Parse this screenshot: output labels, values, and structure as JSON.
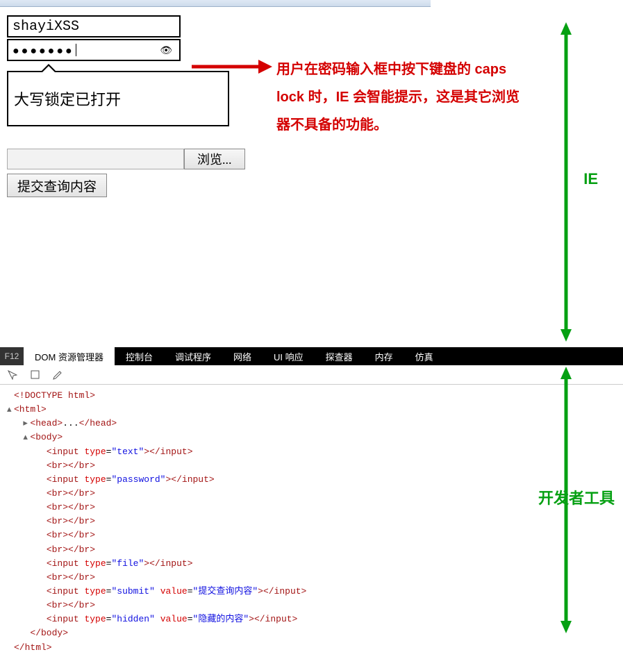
{
  "form": {
    "username_value": "shayiXSS",
    "password_dots": "●●●●●●●",
    "caps_tooltip": "大写锁定已打开",
    "browse_label": "浏览...",
    "submit_label": "提交查询内容"
  },
  "annotations": {
    "red_text": "用户在密码输入框中按下键盘的 caps lock 时，IE 会智能提示，这是其它浏览器不具备的功能。",
    "ie_label": "IE",
    "devtools_label": "开发者工具"
  },
  "devtools": {
    "f12": "F12",
    "tabs": [
      "DOM 资源管理器",
      "控制台",
      "调试程序",
      "网络",
      "UI 响应",
      "探查器",
      "内存",
      "仿真"
    ],
    "dom_lines": [
      {
        "i": 0,
        "pre": "  ",
        "html": "<span class='tag'>&lt;!DOCTYPE html&gt;</span>"
      },
      {
        "i": 0,
        "pre": "▴ ",
        "html": "<span class='tag'>&lt;html&gt;</span>"
      },
      {
        "i": 1,
        "pre": "▸ ",
        "html": "<span class='tag'>&lt;head&gt;</span><span class='txt'>...</span><span class='tag'>&lt;/head&gt;</span>"
      },
      {
        "i": 1,
        "pre": "▴ ",
        "html": "<span class='tag'>&lt;body&gt;</span>"
      },
      {
        "i": 2,
        "pre": "  ",
        "html": "<span class='tag'>&lt;input</span> <span class='attn'>type</span>=<span class='attv'>\"text\"</span><span class='tag'>&gt;&lt;/input&gt;</span>"
      },
      {
        "i": 2,
        "pre": "  ",
        "html": "<span class='tag'>&lt;br&gt;&lt;/br&gt;</span>"
      },
      {
        "i": 2,
        "pre": "  ",
        "html": "<span class='tag'>&lt;input</span> <span class='attn'>type</span>=<span class='attv'>\"password\"</span><span class='tag'>&gt;&lt;/input&gt;</span>"
      },
      {
        "i": 2,
        "pre": "  ",
        "html": "<span class='tag'>&lt;br&gt;&lt;/br&gt;</span>"
      },
      {
        "i": 2,
        "pre": "  ",
        "html": "<span class='tag'>&lt;br&gt;&lt;/br&gt;</span>"
      },
      {
        "i": 2,
        "pre": "  ",
        "html": "<span class='tag'>&lt;br&gt;&lt;/br&gt;</span>"
      },
      {
        "i": 2,
        "pre": "  ",
        "html": "<span class='tag'>&lt;br&gt;&lt;/br&gt;</span>"
      },
      {
        "i": 2,
        "pre": "  ",
        "html": "<span class='tag'>&lt;br&gt;&lt;/br&gt;</span>"
      },
      {
        "i": 2,
        "pre": "  ",
        "html": "<span class='tag'>&lt;input</span> <span class='attn'>type</span>=<span class='attv'>\"file\"</span><span class='tag'>&gt;&lt;/input&gt;</span>"
      },
      {
        "i": 2,
        "pre": "  ",
        "html": "<span class='tag'>&lt;br&gt;&lt;/br&gt;</span>"
      },
      {
        "i": 2,
        "pre": "  ",
        "html": "<span class='tag'>&lt;input</span> <span class='attn'>type</span>=<span class='attv'>\"submit\"</span> <span class='attn'>value</span>=<span class='attv'>\"提交查询内容\"</span><span class='tag'>&gt;&lt;/input&gt;</span>"
      },
      {
        "i": 2,
        "pre": "  ",
        "html": "<span class='tag'>&lt;br&gt;&lt;/br&gt;</span>"
      },
      {
        "i": 2,
        "pre": "  ",
        "html": "<span class='tag'>&lt;input</span> <span class='attn'>type</span>=<span class='attv'>\"hidden\"</span> <span class='attn'>value</span>=<span class='attv'>\"隐藏的内容\"</span><span class='tag'>&gt;&lt;/input&gt;</span>"
      },
      {
        "i": 1,
        "pre": "  ",
        "html": "<span class='tag'>&lt;/body&gt;</span>"
      },
      {
        "i": 0,
        "pre": "  ",
        "html": "<span class='tag'>&lt;/html&gt;</span>"
      }
    ]
  }
}
